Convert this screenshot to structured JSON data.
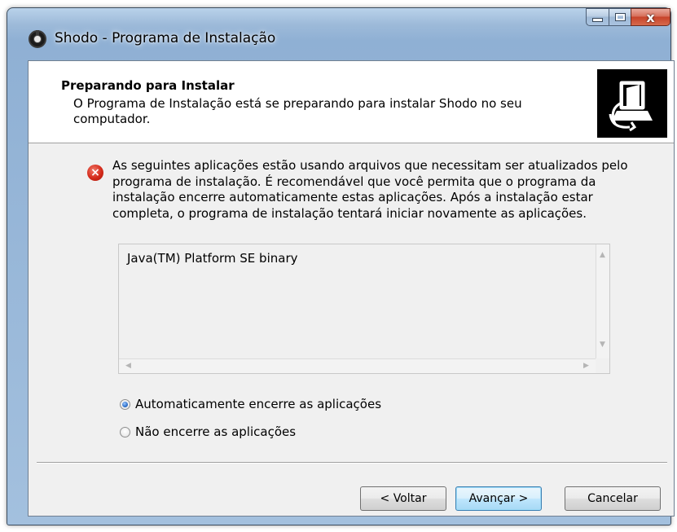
{
  "window": {
    "title": "Shodo - Programa de Instalação",
    "close_glyph": "x"
  },
  "header": {
    "title": "Preparando para Instalar",
    "description": "O Programa de Instalação está se preparando para instalar Shodo no seu computador.",
    "image_icon": "installer-computer-icon"
  },
  "message": {
    "icon": "error-icon",
    "text": "As seguintes aplicações estão usando arquivos que necessitam ser atualizados pelo programa de instalação. É recomendável que você permita que o programa da instalação encerre automaticamente estas aplicações. Após a instalação estar completa, o programa de instalação tentará iniciar novamente as aplicações."
  },
  "applications": [
    "Java(TM) Platform SE binary"
  ],
  "options": [
    {
      "label": "Automaticamente encerre as aplicações",
      "checked": true
    },
    {
      "label": "Não encerre as aplicações",
      "checked": false
    }
  ],
  "buttons": {
    "back": "< Voltar",
    "next": "Avançar >",
    "cancel": "Cancelar"
  },
  "colors": {
    "error": "#d42a1a",
    "default_button_border": "#3c7fb1"
  }
}
